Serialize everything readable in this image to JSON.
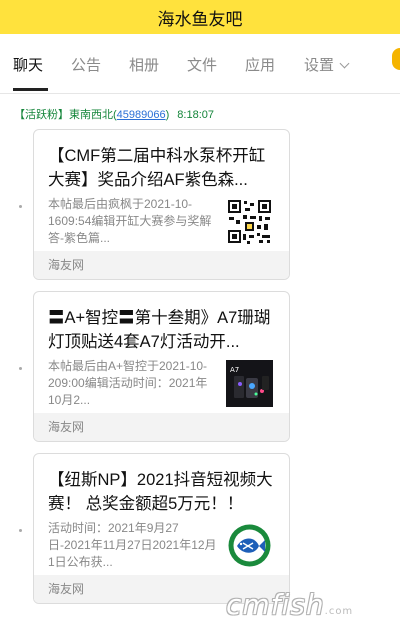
{
  "window": {
    "title": "海水鱼友吧"
  },
  "tabs": [
    {
      "label": "聊天",
      "active": true
    },
    {
      "label": "公告",
      "active": false
    },
    {
      "label": "相册",
      "active": false
    },
    {
      "label": "文件",
      "active": false
    },
    {
      "label": "应用",
      "active": false
    },
    {
      "label": "设置",
      "active": false
    }
  ],
  "message": {
    "badge": "【活跃粉】",
    "sender": "東南西北(",
    "uid": "45989066",
    "sender_close": ")",
    "time": "8:18:07"
  },
  "cards": [
    {
      "title": "【CMF第二届中科水泵杯开缸大赛】奖品介绍AF紫色森...",
      "desc": "本帖最后由疯枫于2021-10-1609:54编辑开缸大赛参与奖解答-紫色篇...",
      "thumb": "qr-code-image",
      "source": "海友网"
    },
    {
      "title": "〓A+智控〓第十叁期》A7珊瑚灯顶贴送4套A7灯活动开...",
      "desc": "本帖最后由A+智控于2021-10-209:00编辑活动时间：2021年10月2...",
      "thumb": "a7-light-product-image",
      "thumb_text": "A7",
      "source": "海友网"
    },
    {
      "title": "【纽斯NP】2021抖音短视频大赛！ 总奖金额超5万元！！",
      "desc": "活动时间：2021年9月27日-2021年11月27日2021年12月1日公布获...",
      "thumb": "fish-logo-image",
      "source": "海友网"
    }
  ],
  "watermark": {
    "text": "cmfish",
    "suffix": ".com"
  },
  "colors": {
    "title_bar": "#ffe23d",
    "fan_badge": "#14853a",
    "uid_link": "#2a6fd6"
  },
  "icons": {
    "settings_dropdown": "chevron-down-icon",
    "edge": "app-edge-icon"
  }
}
